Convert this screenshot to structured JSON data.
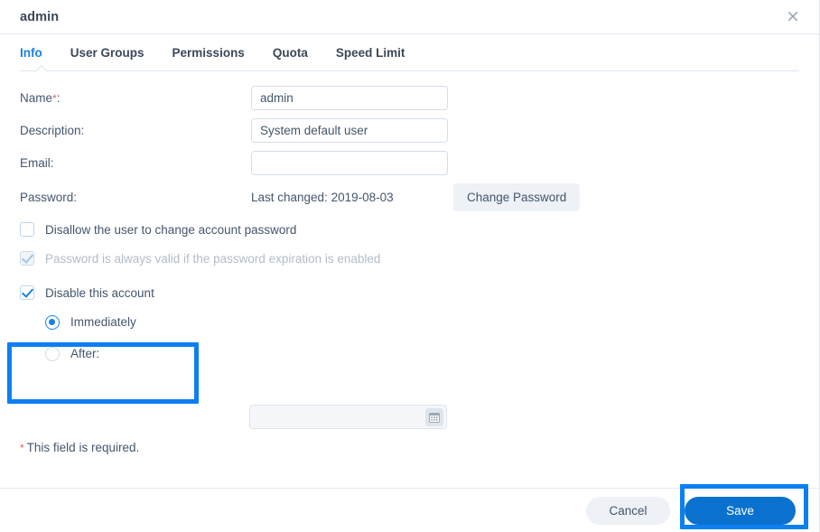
{
  "window": {
    "title": "admin",
    "close_label": "×"
  },
  "tabs": [
    {
      "label": "Info",
      "active": true
    },
    {
      "label": "User Groups",
      "active": false
    },
    {
      "label": "Permissions",
      "active": false
    },
    {
      "label": "Quota",
      "active": false
    },
    {
      "label": "Speed Limit",
      "active": false
    }
  ],
  "form": {
    "name": {
      "label": "Name",
      "required_mark": "*",
      "label_suffix": ":",
      "value": "admin",
      "placeholder": ""
    },
    "description": {
      "label": "Description:",
      "value": "System default user",
      "placeholder": ""
    },
    "email": {
      "label": "Email:",
      "value": "",
      "placeholder": ""
    },
    "password": {
      "label": "Password:",
      "last_changed": "Last changed: 2019-08-03",
      "change_button": "Change Password"
    },
    "disallow_change": {
      "label": "Disallow the user to change account password",
      "checked": false,
      "disabled": false
    },
    "always_valid": {
      "label": "Password is always valid if the password expiration is enabled",
      "checked": true,
      "disabled": true
    },
    "disable_account": {
      "label": "Disable this account",
      "checked": true
    },
    "immediately": {
      "label": "Immediately",
      "selected": true
    },
    "after": {
      "label": "After:",
      "selected": false,
      "date_value": "",
      "date_placeholder": "",
      "calendar_icon": "calendar-icon"
    },
    "required_note": {
      "star": "*",
      "text": "This field is required."
    }
  },
  "footer": {
    "cancel_label": "Cancel",
    "save_label": "Save"
  },
  "annotations": {
    "color": "#0c7ff2",
    "highlighted": [
      "disable-this-account-group",
      "save-button"
    ]
  },
  "colors": {
    "accent": "#1a82e2",
    "save_button": "#0a72ce",
    "required_star": "#e0616c",
    "text": "#44566c",
    "disabled_text": "#b2bcc8"
  }
}
